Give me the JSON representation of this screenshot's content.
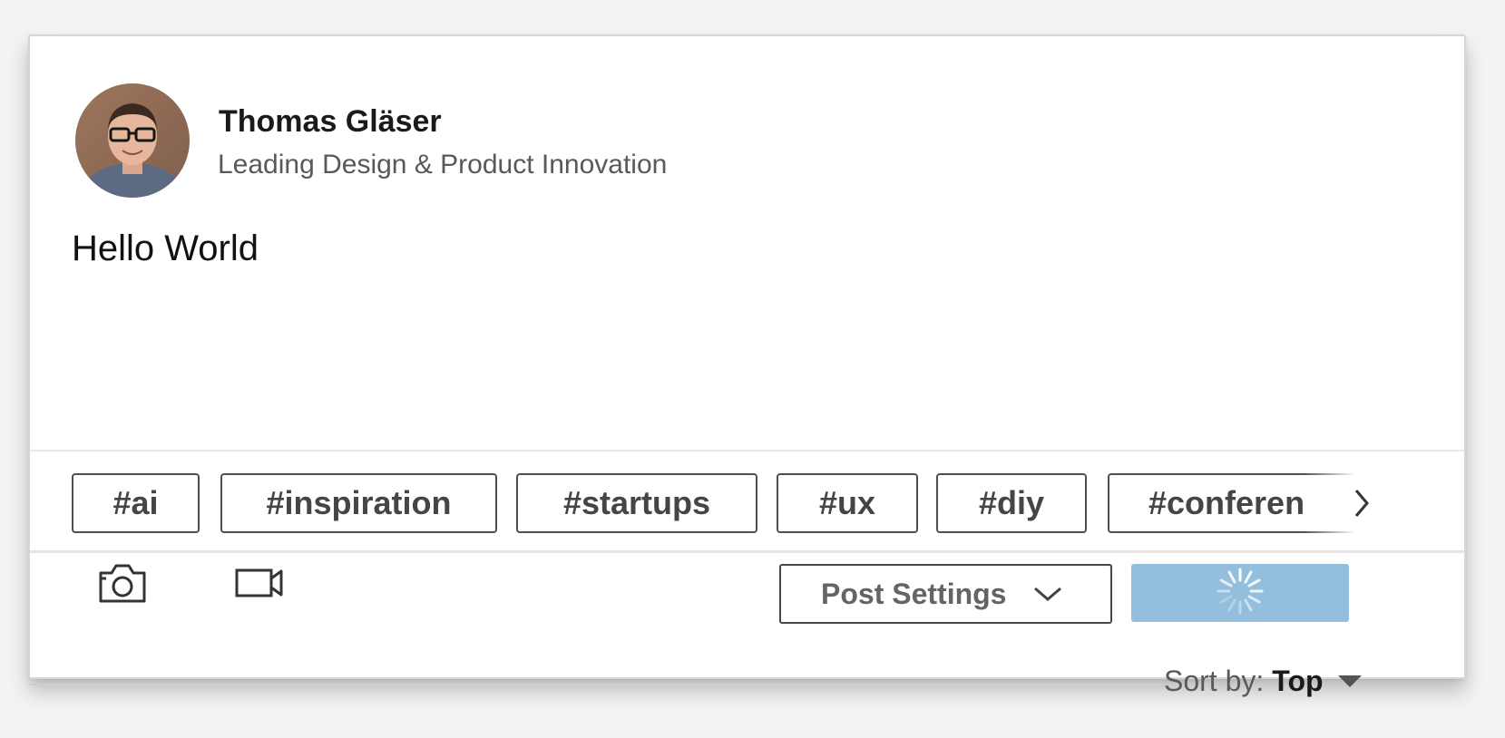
{
  "author": {
    "name": "Thomas Gläser",
    "headline": "Leading Design & Product Innovation"
  },
  "post": {
    "text": "Hello World"
  },
  "hashtags": [
    "#ai",
    "#inspiration",
    "#startups",
    "#ux",
    "#diy",
    "#conferen"
  ],
  "actions": {
    "photo_icon": "camera-icon",
    "video_icon": "video-icon",
    "post_settings_label": "Post Settings",
    "post_button_state": "loading"
  },
  "feed": {
    "sort_label": "Sort by:",
    "sort_value": "Top"
  },
  "colors": {
    "post_button": "#93bedd",
    "tag_border": "#4f4f4f",
    "background": "#f3f3f3"
  }
}
